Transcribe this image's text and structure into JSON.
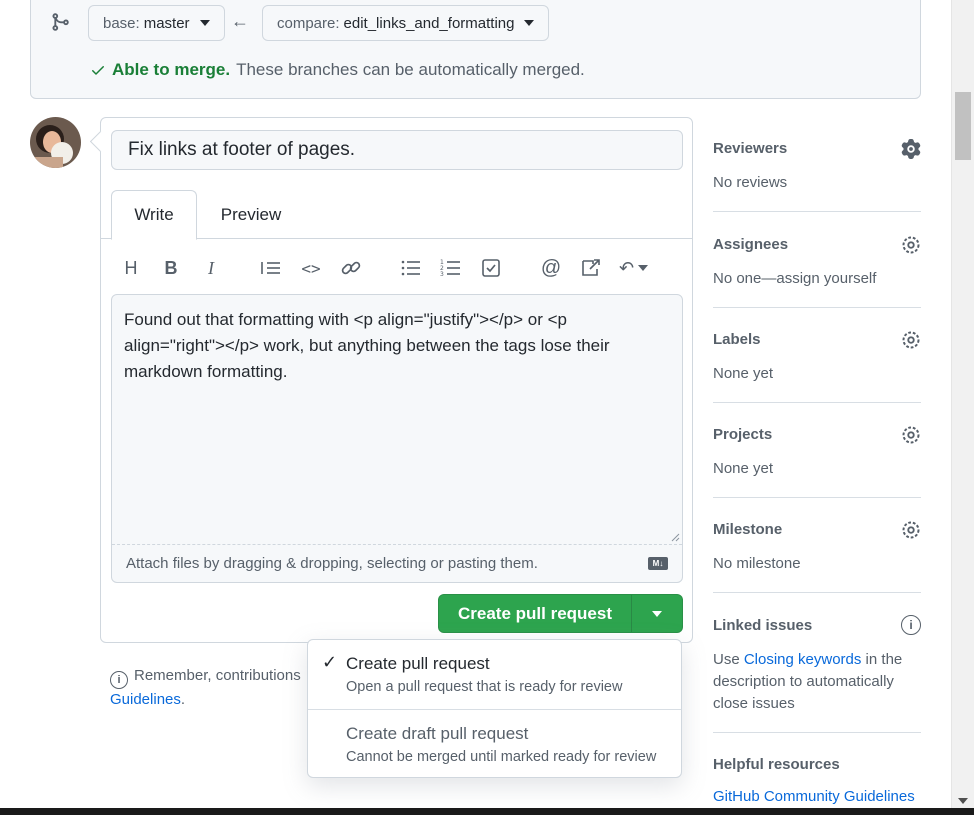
{
  "compare": {
    "base_prefix": "base:",
    "base_branch": "master",
    "compare_prefix": "compare:",
    "compare_branch": "edit_links_and_formatting",
    "merge_ok": "Able to merge.",
    "merge_msg": "These branches can be automatically merged."
  },
  "form": {
    "title_value": "Fix links at footer of pages.",
    "tabs": [
      "Write",
      "Preview"
    ],
    "body_text": "Found out that formatting with <p align=\"justify\"></p> or <p align=\"right\"></p> work, but anything between the tags lose their markdown formatting.",
    "attach_hint": "Attach files by dragging & dropping, selecting or pasting them.",
    "md_badge": "M↓",
    "submit_label": "Create pull request"
  },
  "remember": {
    "text": "Remember, contributions",
    "link": "Guidelines",
    "tail": "."
  },
  "menu": {
    "items": [
      {
        "title": "Create pull request",
        "desc": "Open a pull request that is ready for review",
        "selected": true
      },
      {
        "title": "Create draft pull request",
        "desc": "Cannot be merged until marked ready for review",
        "selected": false
      }
    ]
  },
  "sidebar": {
    "reviewers": {
      "title": "Reviewers",
      "value": "No reviews"
    },
    "assignees": {
      "title": "Assignees",
      "value": "No one—assign yourself"
    },
    "labels": {
      "title": "Labels",
      "value": "None yet"
    },
    "projects": {
      "title": "Projects",
      "value": "None yet"
    },
    "milestone": {
      "title": "Milestone",
      "value": "No milestone"
    },
    "linked": {
      "title": "Linked issues",
      "pre": "Use ",
      "link": "Closing keywords",
      "post": " in the description to automatically close issues"
    },
    "helpful_title": "Helpful resources",
    "helpful_link": "GitHub Community Guidelines"
  },
  "colors": {
    "green": "#2da44e",
    "link": "#0969da",
    "success_text": "#1a7f37",
    "border": "#d0d7de"
  }
}
